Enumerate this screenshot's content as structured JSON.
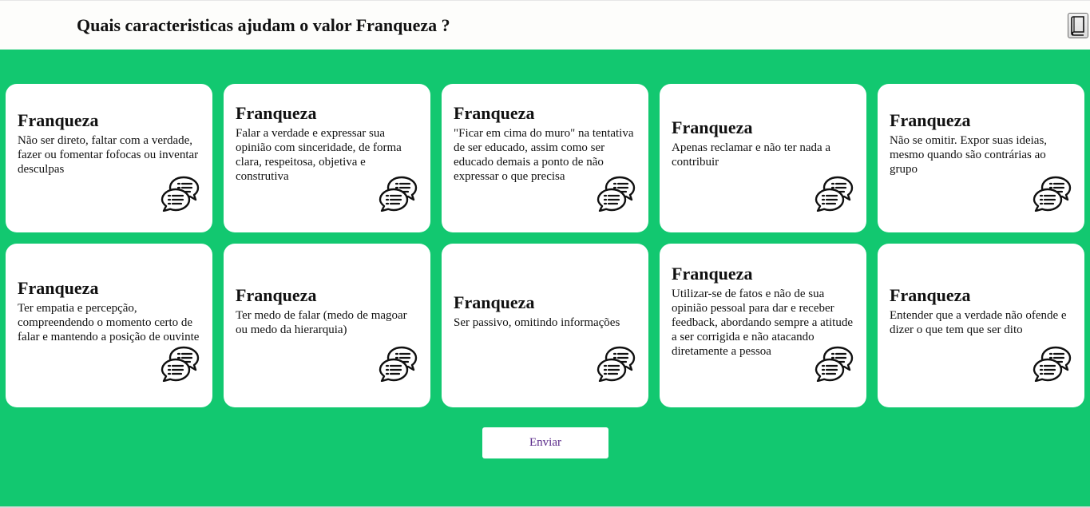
{
  "header": {
    "question": "Quais caracteristicas ajudam o valor Franqueza ?",
    "book_icon": "book-icon"
  },
  "cards": [
    {
      "title": "Franqueza",
      "text": "Não ser direto, faltar com a verdade, fazer ou fomentar fofocas ou inventar desculpas",
      "icon": "chat-bubbles-icon"
    },
    {
      "title": "Franqueza",
      "text": "Falar a verdade e expressar sua opinião com sinceridade, de forma clara, respeitosa, objetiva e construtiva",
      "icon": "chat-bubbles-icon"
    },
    {
      "title": "Franqueza",
      "text": "\"Ficar em cima do muro\" na tentativa de ser educado, assim como ser educado demais a ponto de não expressar o que precisa",
      "icon": "chat-bubbles-icon"
    },
    {
      "title": "Franqueza",
      "text": "Apenas reclamar e não ter nada a contribuir",
      "icon": "chat-bubbles-icon"
    },
    {
      "title": "Franqueza",
      "text": "Não se omitir. Expor suas ideias, mesmo quando são contrárias ao grupo",
      "icon": "chat-bubbles-icon"
    },
    {
      "title": "Franqueza",
      "text": "Ter empatia e percepção, compreendendo o momento certo de falar e mantendo a posição de ouvinte",
      "icon": "chat-bubbles-icon"
    },
    {
      "title": "Franqueza",
      "text": "Ter medo de falar (medo de magoar ou medo da hierarquia)",
      "icon": "chat-bubbles-icon"
    },
    {
      "title": "Franqueza",
      "text": "Ser passivo, omitindo informações",
      "icon": "chat-bubbles-icon"
    },
    {
      "title": "Franqueza",
      "text": "Utilizar-se de fatos e não de sua opinião pessoal para dar e receber feedback, abordando sempre a atitude a ser corrigida e não atacando diretamente a pessoa",
      "icon": "chat-bubbles-icon"
    },
    {
      "title": "Franqueza",
      "text": "Entender que a verdade não ofende e dizer o que tem que ser dito",
      "icon": "chat-bubbles-icon"
    }
  ],
  "submit": {
    "label": "Enviar"
  },
  "colors": {
    "background": "#12c870",
    "card": "#ffffff",
    "button_text": "#5a2a8a"
  }
}
